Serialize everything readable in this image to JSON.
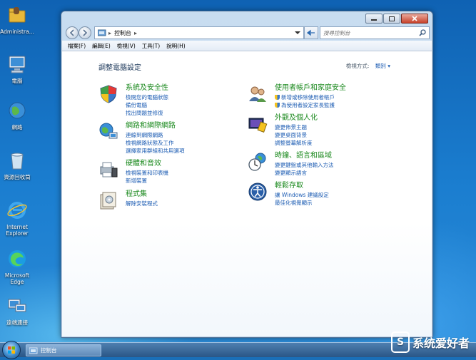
{
  "desktop": {
    "icons": [
      {
        "label": "Administra..."
      },
      {
        "label": "電腦"
      },
      {
        "label": "網路"
      },
      {
        "label": "資源回收筒"
      },
      {
        "label": "Internet Explorer"
      },
      {
        "label": "Microsoft Edge"
      },
      {
        "label": "遠端連接"
      }
    ]
  },
  "window": {
    "address": {
      "root": "控制台",
      "separator": "▸"
    },
    "search_placeholder": "搜尋控制台",
    "menu": [
      "檔案(F)",
      "編輯(E)",
      "檢視(V)",
      "工具(T)",
      "說明(H)"
    ],
    "page_title": "調整電腦設定",
    "view_by_label": "檢視方式:",
    "view_by_value": "類別 ▾",
    "categories": [
      {
        "title": "系統及安全性",
        "links": [
          "檢閱您的電腦狀態",
          "備份電腦",
          "找出問題並修復"
        ]
      },
      {
        "title": "網路和網際網路",
        "links": [
          "連線到網際網路",
          "檢視網路狀態及工作",
          "選擇家用群組和共用選項"
        ]
      },
      {
        "title": "硬體和音效",
        "links": [
          "檢視裝置和印表機",
          "新增裝置"
        ]
      },
      {
        "title": "程式集",
        "links": [
          "解除安裝程式"
        ]
      },
      {
        "title": "使用者帳戶和家庭安全",
        "links": [
          "新增或移除使用者帳戶",
          "為使用者設定家長監護"
        ]
      },
      {
        "title": "外觀及個人化",
        "links": [
          "變更佈景主題",
          "變更桌面背景",
          "調整螢幕解析度"
        ]
      },
      {
        "title": "時鐘、語言和區域",
        "links": [
          "變更鍵盤或其他輸入方法",
          "變更顯示語言"
        ]
      },
      {
        "title": "輕鬆存取",
        "links": [
          "讓 Windows 建議設定",
          "最佳化視覺顯示"
        ]
      }
    ]
  },
  "taskbar": {
    "item_label": "控制台"
  },
  "watermark": {
    "text": "系统爱好者",
    "logo": "S"
  },
  "colors": {
    "accent_link": "#1c5cb3",
    "category_title": "#1c8a1f",
    "desktop": "#1b7ed0"
  }
}
